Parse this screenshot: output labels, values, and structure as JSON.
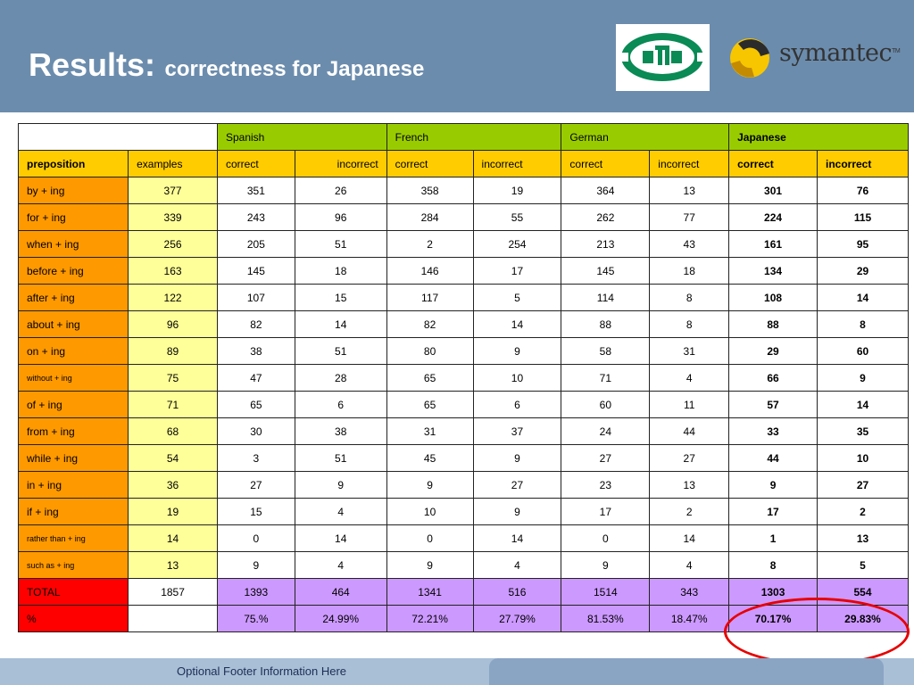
{
  "slide": {
    "title_main": "Results:",
    "title_sub": "correctness for Japanese",
    "footer": "Optional Footer Information Here"
  },
  "logos": {
    "cts": "CTS",
    "symantec": "symantec",
    "symantec_tm": "TM"
  },
  "colors": {
    "header_bg": "#6b8cad",
    "language_header": "#99cc00",
    "subheader": "#ffcc00",
    "preposition_col": "#ff9900",
    "examples_col": "#ffff99",
    "total_label": "#ff0000",
    "totals_bg": "#cc99ff",
    "highlight_circle": "#e60000"
  },
  "table": {
    "languages": [
      "Spanish",
      "French",
      "German",
      "Japanese"
    ],
    "sub_headers": [
      "preposition",
      "examples",
      "correct",
      "incorrect",
      "correct",
      "incorrect",
      "correct",
      "incorrect",
      "correct",
      "incorrect"
    ],
    "rows": [
      [
        "by + ing",
        "377",
        "351",
        "26",
        "358",
        "19",
        "364",
        "13",
        "301",
        "76"
      ],
      [
        "for + ing",
        "339",
        "243",
        "96",
        "284",
        "55",
        "262",
        "77",
        "224",
        "115"
      ],
      [
        "when + ing",
        "256",
        "205",
        "51",
        "2",
        "254",
        "213",
        "43",
        "161",
        "95"
      ],
      [
        "before + ing",
        "163",
        "145",
        "18",
        "146",
        "17",
        "145",
        "18",
        "134",
        "29"
      ],
      [
        "after + ing",
        "122",
        "107",
        "15",
        "117",
        "5",
        "114",
        "8",
        "108",
        "14"
      ],
      [
        "about + ing",
        "96",
        "82",
        "14",
        "82",
        "14",
        "88",
        "8",
        "88",
        "8"
      ],
      [
        "on + ing",
        "89",
        "38",
        "51",
        "80",
        "9",
        "58",
        "31",
        "29",
        "60"
      ],
      [
        "without + ing",
        "75",
        "47",
        "28",
        "65",
        "10",
        "71",
        "4",
        "66",
        "9"
      ],
      [
        "of + ing",
        "71",
        "65",
        "6",
        "65",
        "6",
        "60",
        "11",
        "57",
        "14"
      ],
      [
        "from + ing",
        "68",
        "30",
        "38",
        "31",
        "37",
        "24",
        "44",
        "33",
        "35"
      ],
      [
        "while + ing",
        "54",
        "3",
        "51",
        "45",
        "9",
        "27",
        "27",
        "44",
        "10"
      ],
      [
        "in + ing",
        "36",
        "27",
        "9",
        "9",
        "27",
        "23",
        "13",
        "9",
        "27"
      ],
      [
        "if + ing",
        "19",
        "15",
        "4",
        "10",
        "9",
        "17",
        "2",
        "17",
        "2"
      ],
      [
        "rather than + ing",
        "14",
        "0",
        "14",
        "0",
        "14",
        "0",
        "14",
        "1",
        "13"
      ],
      [
        "such as + ing",
        "13",
        "9",
        "4",
        "9",
        "4",
        "9",
        "4",
        "8",
        "5"
      ]
    ],
    "small_rows": [
      7,
      13,
      14
    ],
    "total_row": [
      "TOTAL",
      "1857",
      "1393",
      "464",
      "1341",
      "516",
      "1514",
      "343",
      "1303",
      "554"
    ],
    "percent_row": [
      "%",
      "",
      "75.%",
      "24.99%",
      "72.21%",
      "27.79%",
      "81.53%",
      "18.47%",
      "70.17%",
      "29.83%"
    ]
  }
}
